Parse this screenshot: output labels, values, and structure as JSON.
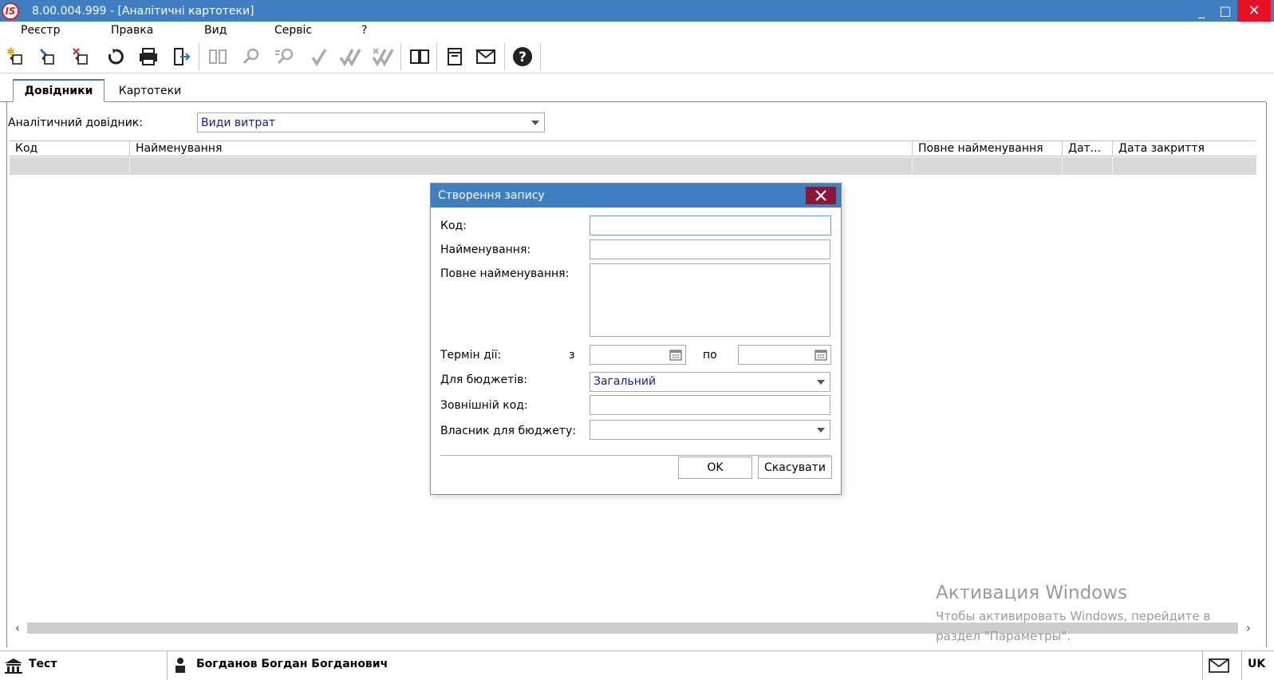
{
  "window": {
    "title": "8.00.004.999 - [Аналітичні картотеки]",
    "logo_text": "IS",
    "minimize": "_",
    "maximize": "□",
    "close": "✕"
  },
  "menu": [
    "Реєстр",
    "Правка",
    "Вид",
    "Сервіс",
    "?"
  ],
  "toolbar_icons": [
    "new-record-icon",
    "edit-record-icon",
    "delete-record-icon",
    "refresh-icon",
    "print-icon",
    "export-icon",
    "book-open-icon",
    "search-icon",
    "search-next-icon",
    "check-icon",
    "check-all-icon",
    "uncheck-icon",
    "reference-book-icon",
    "document-icon",
    "mail-icon",
    "help-icon"
  ],
  "tabs": [
    {
      "label": "Довідники",
      "active": true
    },
    {
      "label": "Картотеки",
      "active": false
    }
  ],
  "directory": {
    "label": "Аналітичний довідник:",
    "value": "Види витрат"
  },
  "grid": {
    "columns": [
      "Код",
      "Найменування",
      "Повне найменування",
      "Дат...",
      "Дата закриття"
    ]
  },
  "watermark": {
    "title": "Активация Windows",
    "line1": "Чтобы активировать Windows, перейдите в",
    "line2": "раздел \"Параметры\"."
  },
  "status": {
    "org": "Тест",
    "user": "Богданов Богдан Богданович",
    "lang": "UK"
  },
  "dialog": {
    "title": "Створення запису",
    "code_label": "Код:",
    "code_value": "",
    "name_label": "Найменування:",
    "name_value": "",
    "full_name_label": "Повне найменування:",
    "full_name_value": "",
    "term_label": "Термін дії:",
    "from_label": "з",
    "to_label": "по",
    "from_value": "",
    "to_value": "",
    "budget_label": "Для бюджетів:",
    "budget_value": "Загальний",
    "external_code_label": "Зовнішній код:",
    "external_code_value": "",
    "owner_label": "Власник для бюджету:",
    "owner_value": "",
    "ok_label": "OK",
    "cancel_label": "Скасувати"
  },
  "colors": {
    "titlebar": "#3f7fc1",
    "close_red": "#e81123",
    "dialog_close": "#8b1536",
    "value_text": "#1a1a8c",
    "selected_row": "#d9d9d9"
  }
}
